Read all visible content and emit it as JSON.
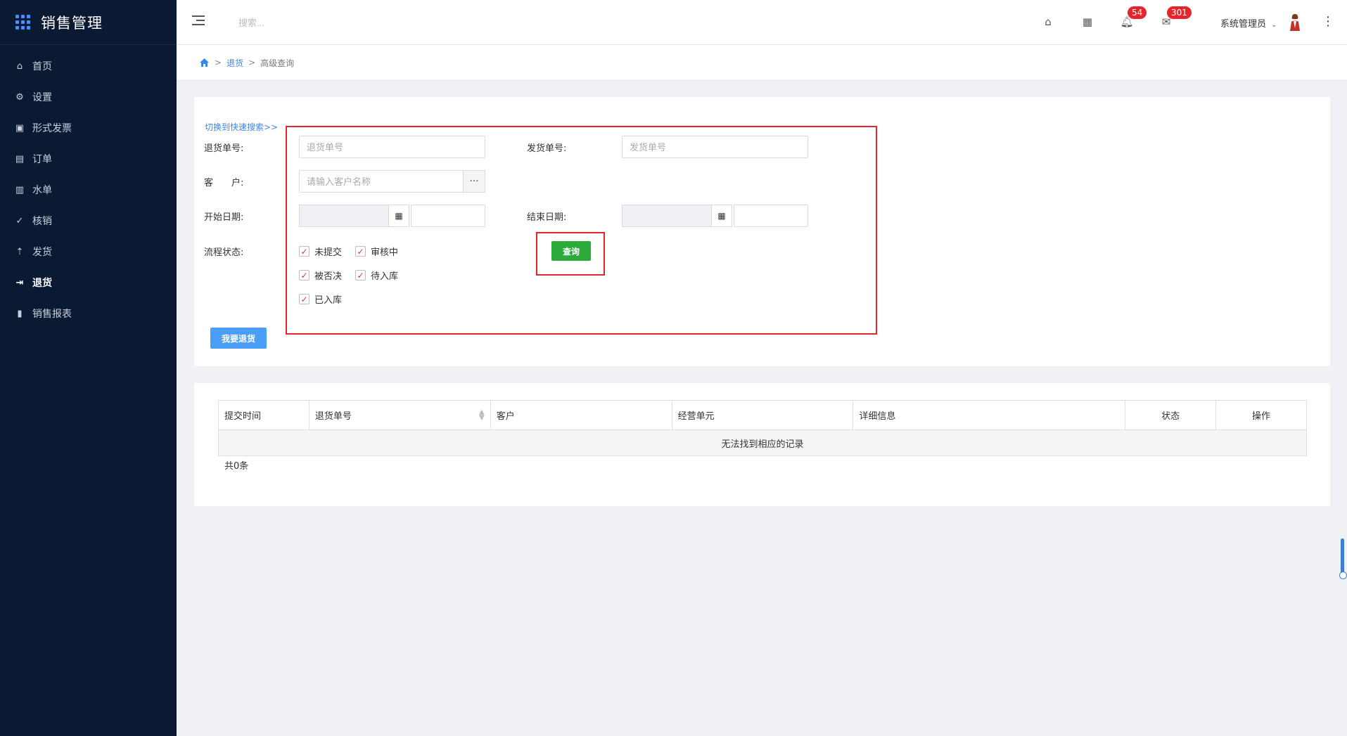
{
  "app": {
    "title": "销售管理"
  },
  "sidebar": {
    "items": [
      {
        "label": "首页",
        "icon": "home-icon"
      },
      {
        "label": "设置",
        "icon": "gear-icon"
      },
      {
        "label": "形式发票",
        "icon": "invoice-icon"
      },
      {
        "label": "订单",
        "icon": "order-icon"
      },
      {
        "label": "水单",
        "icon": "receipt-icon"
      },
      {
        "label": "核销",
        "icon": "check-circle-icon"
      },
      {
        "label": "发货",
        "icon": "upload-icon"
      },
      {
        "label": "退货",
        "icon": "return-icon",
        "active": true
      },
      {
        "label": "销售报表",
        "icon": "bar-chart-icon"
      }
    ]
  },
  "header": {
    "search_placeholder": "搜索...",
    "notifications_count": "54",
    "messages_count": "301",
    "user_name": "系统管理员"
  },
  "breadcrumb": {
    "section": "退货",
    "current": "高级查询"
  },
  "search_form": {
    "switch_link": "切换到快速搜索>>",
    "return_no_label": "退货单号:",
    "return_no_placeholder": "退货单号",
    "ship_no_label": "发货单号:",
    "ship_no_placeholder": "发货单号",
    "customer_label": "客　　户:",
    "customer_placeholder": "请输入客户名称",
    "start_date_label": "开始日期:",
    "end_date_label": "结束日期:",
    "status_label": "流程状态:",
    "statuses": [
      {
        "label": "未提交",
        "checked": true
      },
      {
        "label": "审核中",
        "checked": true
      },
      {
        "label": "被否决",
        "checked": true
      },
      {
        "label": "待入库",
        "checked": true
      },
      {
        "label": "已入库",
        "checked": true
      }
    ],
    "query_button": "查询",
    "return_button": "我要退货"
  },
  "results_table": {
    "columns": [
      "提交时间",
      "退货单号",
      "客户",
      "经营单元",
      "详细信息",
      "状态",
      "操作"
    ],
    "empty_message": "无法找到相应的记录",
    "total": "共0条"
  },
  "colors": {
    "sidebar_bg": "#0b1a33",
    "accent_blue": "#4a9ef5",
    "query_green": "#2cab3c",
    "badge_red": "#e8232a",
    "highlight_red": "#e3262c"
  }
}
